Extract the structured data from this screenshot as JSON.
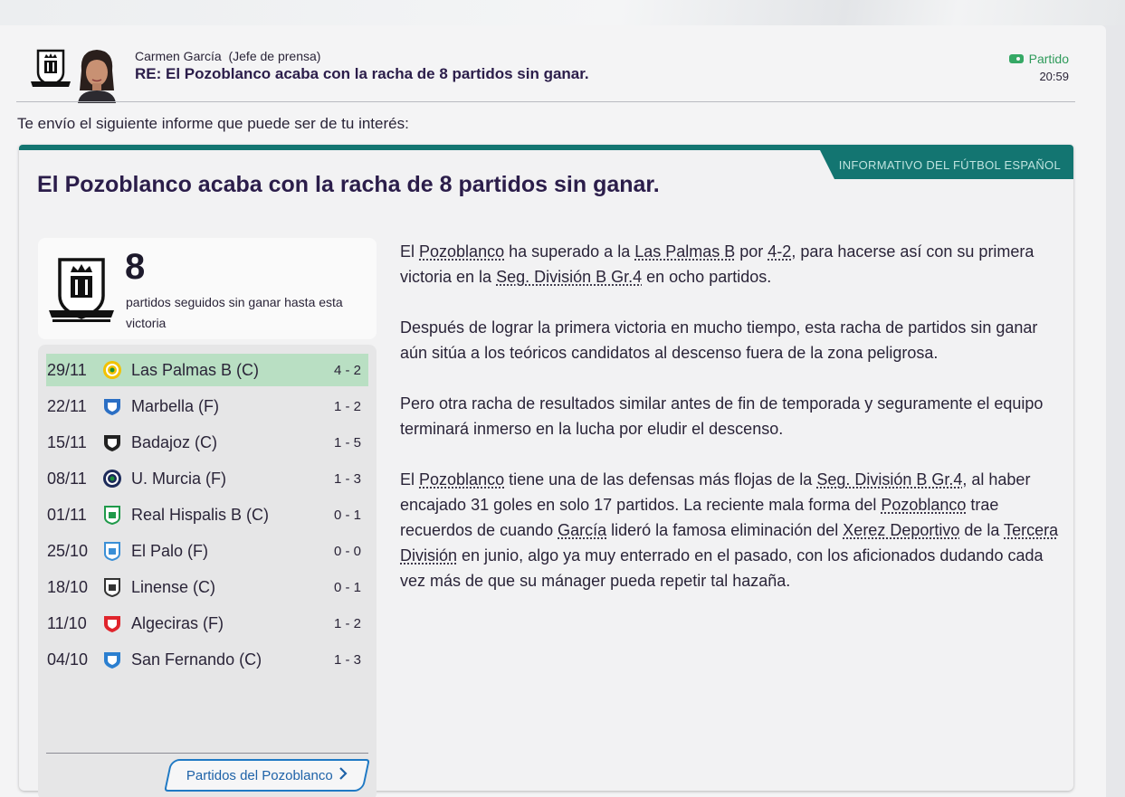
{
  "message": {
    "sender_name": "Carmen García",
    "sender_role": "(Jefe de prensa)",
    "subject": "RE: El Pozoblanco acaba con la racha de 8 partidos sin ganar.",
    "tag_label": "Partido",
    "time": "20:59",
    "intro": "Te envío el siguiente informe que puede ser de tu interés:"
  },
  "article": {
    "source": "INFORMATIVO DEL FÚTBOL ESPAÑOL",
    "headline": "El Pozoblanco acaba con la racha de 8 partidos sin ganar.",
    "streak": {
      "number": "8",
      "description": "partidos seguidos sin ganar hasta esta victoria"
    },
    "results": [
      {
        "date": "29/11",
        "team": "Las Palmas B (C)",
        "score": "4 - 2",
        "win": true,
        "badge_color": "#f2c200",
        "badge_shape": "circle"
      },
      {
        "date": "22/11",
        "team": "Marbella (F)",
        "score": "1 - 2",
        "win": false,
        "badge_color": "#2b6fc4",
        "badge_shape": "shield"
      },
      {
        "date": "15/11",
        "team": "Badajoz (C)",
        "score": "1 - 5",
        "win": false,
        "badge_color": "#222222",
        "badge_shape": "shield"
      },
      {
        "date": "08/11",
        "team": "U. Murcia (F)",
        "score": "1 - 3",
        "win": false,
        "badge_color": "#1c2a5a",
        "badge_shape": "circle"
      },
      {
        "date": "01/11",
        "team": "Real Hispalis B (C)",
        "score": "0 - 1",
        "win": false,
        "badge_color": "#1f9a4a",
        "badge_shape": "square"
      },
      {
        "date": "25/10",
        "team": "El Palo (F)",
        "score": "0 - 0",
        "win": false,
        "badge_color": "#3a8fd6",
        "badge_shape": "square"
      },
      {
        "date": "18/10",
        "team": "Linense (C)",
        "score": "0 - 1",
        "win": false,
        "badge_color": "#333333",
        "badge_shape": "square"
      },
      {
        "date": "11/10",
        "team": "Algeciras (F)",
        "score": "1 - 2",
        "win": false,
        "badge_color": "#e0242c",
        "badge_shape": "shield"
      },
      {
        "date": "04/10",
        "team": "San Fernando (C)",
        "score": "1 - 3",
        "win": false,
        "badge_color": "#2b7fd0",
        "badge_shape": "shield"
      }
    ],
    "fixtures_button": "Partidos del Pozoblanco",
    "paragraphs": {
      "p1": {
        "t1": "El ",
        "l1": "Pozoblanco",
        "t2": " ha superado a la ",
        "l2": "Las Palmas B",
        "t3": " por ",
        "l3": "4-2",
        "t4": ", para hacerse así con su primera victoria en la ",
        "l4": "Seg. División B Gr.4",
        "t5": " en ocho partidos."
      },
      "p2": "Después de lograr la primera victoria en mucho tiempo, esta racha de partidos sin ganar aún sitúa a los teóricos candidatos al descenso fuera de la zona peligrosa.",
      "p3": "Pero otra racha de resultados similar antes de fin de temporada y seguramente el equipo terminará inmerso en la lucha por eludir el descenso.",
      "p4": {
        "t1": "El ",
        "l1": "Pozoblanco",
        "t2": " tiene una de las defensas más flojas de la ",
        "l2": "Seg. División B Gr.4",
        "t3": ", al haber encajado 31 goles en solo 17 partidos. La reciente mala forma del ",
        "l3": "Pozoblanco",
        "t4": " trae recuerdos de cuando ",
        "l4": "García",
        "t5": " lideró la famosa eliminación del ",
        "l5": "Xerez Deportivo",
        "t6": " de la ",
        "l6": "Tercera División",
        "t7": " en junio, algo ya muy enterrado en el pasado, con los aficionados dudando cada vez más de que su mánager pueda repetir tal hazaña."
      }
    }
  }
}
